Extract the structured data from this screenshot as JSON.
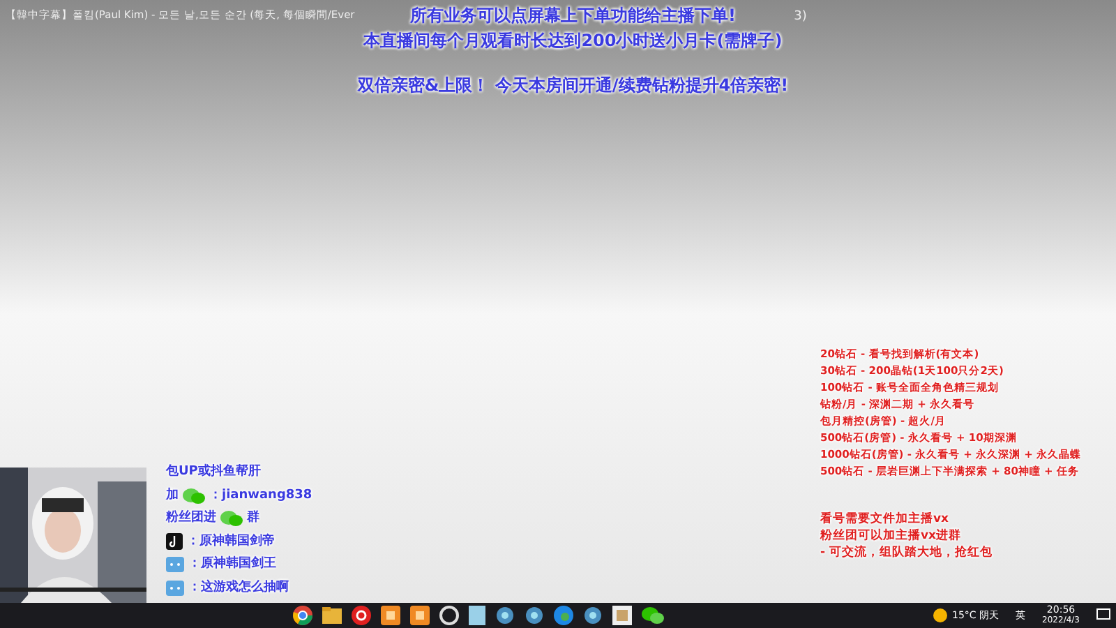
{
  "video_title": {
    "text": "【韓中字幕】폴킴(Paul Kim) - 모든 날,모든 순간 (每天, 每個瞬間/Ever",
    "tail": "3)"
  },
  "notices": [
    {
      "text": "所有业务可以点屏幕上下单功能给主播下单!"
    },
    {
      "text": "本直播间每个月观看时长达到200小时送小月卡(需牌子)"
    },
    {
      "text": "双倍亲密&上限！ 今天本房间开通/续费钻粉提升4倍亲密!"
    }
  ],
  "price_list": [
    "20钻石 - 看号找到解析(有文本)",
    "30钻石 - 200晶钻(1天100只分2天)",
    "100钻石 - 账号全面全角色精三规划",
    "钻粉/月 - 深渊二期 + 永久看号",
    "包月精控(房管) - 超火/月",
    "500钻石(房管) - 永久看号 + 10期深渊",
    "1000钻石(房管) - 永久看号 + 永久深渊 + 永久晶蝶",
    "500钻石 - 层岩巨渊上下半满探索 + 80神瞳 + 任务"
  ],
  "fan_notes": [
    "看号需要文件加主播vx",
    "粉丝团可以加主播vx进群",
    "- 可交流，组队踏大地，抢红包"
  ],
  "contacts": [
    {
      "kind": "text",
      "text": "包UP或抖鱼帮肝"
    },
    {
      "kind": "wechat",
      "before": "加",
      "text": "：jianwang838"
    },
    {
      "kind": "wechat",
      "before": "粉丝团进",
      "text": "群"
    },
    {
      "kind": "tiktok",
      "text": "：原神韩国剑帝"
    },
    {
      "kind": "chat",
      "text": "：原神韩国剑王"
    },
    {
      "kind": "chat",
      "text": "：这游戏怎么抽啊"
    }
  ],
  "taskbar": {
    "weather": "15°C 阴天",
    "ime": "英",
    "time": "20:56",
    "date": "2022/4/3"
  }
}
